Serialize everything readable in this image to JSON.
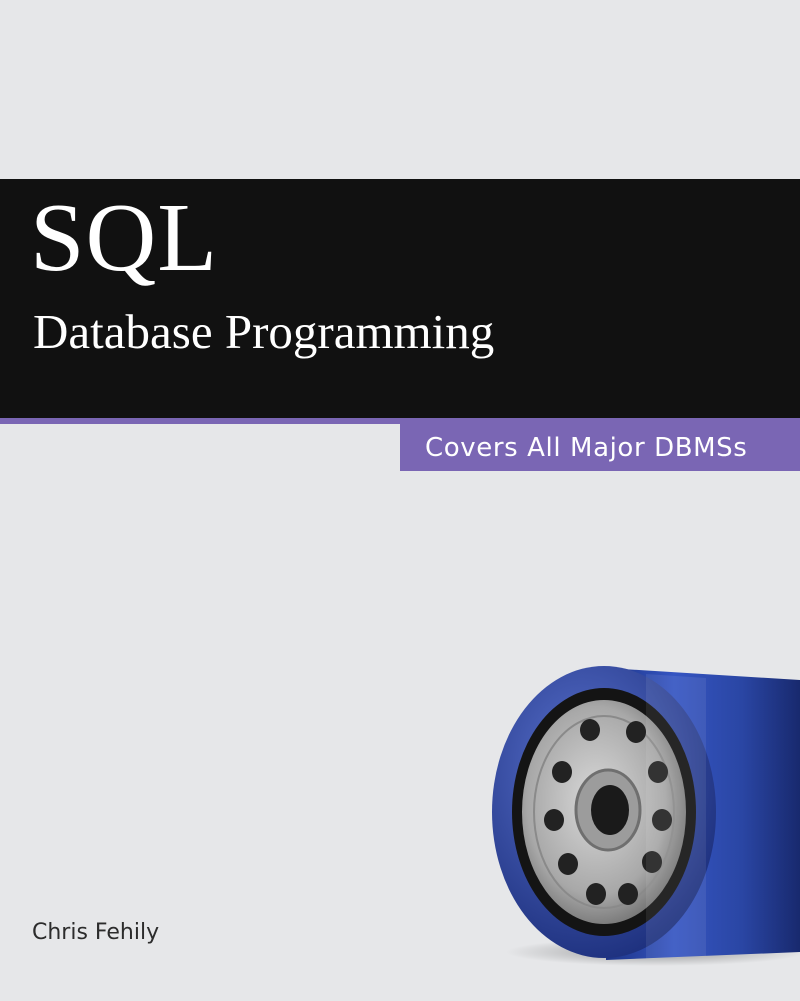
{
  "book": {
    "title": "SQL",
    "subtitle": "Database Programming",
    "tagline": "Covers All Major DBMSs",
    "author": "Chris Fehily"
  },
  "colors": {
    "background": "#e6e7e9",
    "title_band": "#111111",
    "accent": "#7a66b4",
    "text_light": "#ffffff",
    "text_dark": "#2c2c2c",
    "filter_body": "#2c49a8"
  },
  "image": {
    "icon": "oil-filter-icon"
  }
}
